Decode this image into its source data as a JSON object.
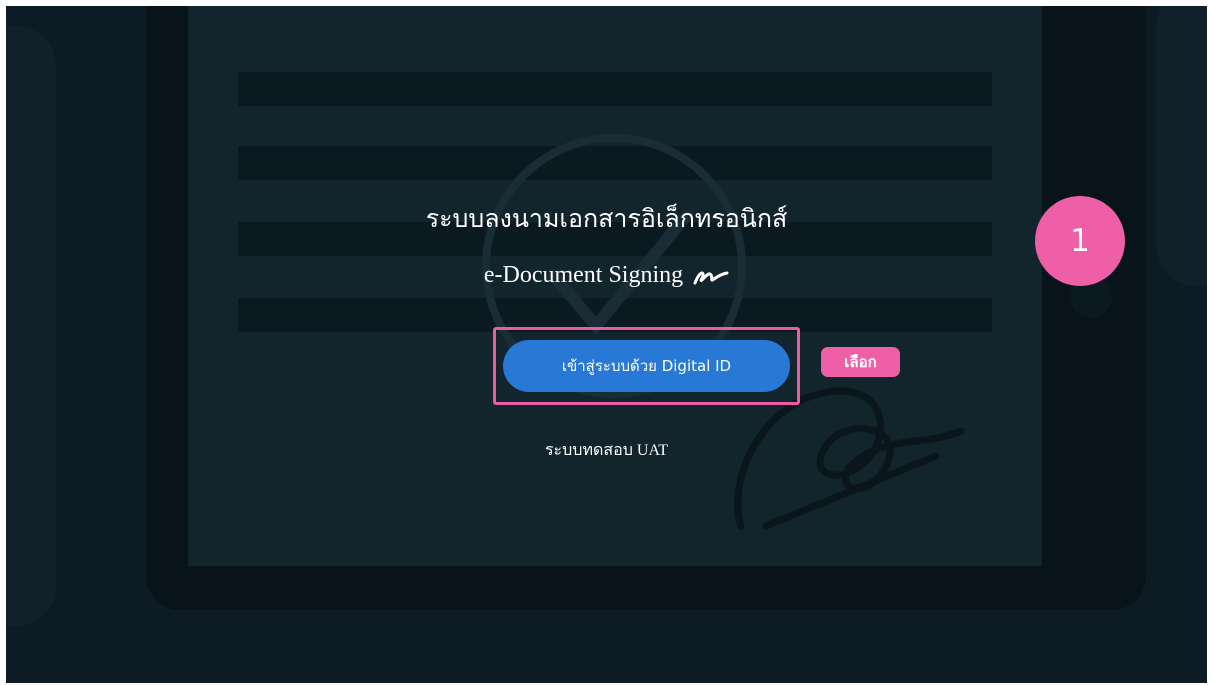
{
  "title_thai": "ระบบลงนามเอกสารอิเล็กทรอนิกส์",
  "title_english": "e-Document Signing",
  "login_button": {
    "label": "เข้าสู่ระบบด้วย Digital ID"
  },
  "annotation": {
    "step_number": "1",
    "choose_label": "เลือก"
  },
  "environment_label": "ระบบทดสอบ UAT",
  "colors": {
    "background": "#0d1c24",
    "button": "#2878d6",
    "highlight": "#ec5ba3",
    "text": "#ffffff"
  }
}
